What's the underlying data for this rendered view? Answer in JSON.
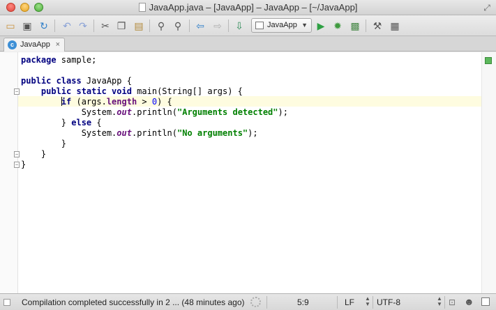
{
  "window": {
    "title": "JavaApp.java – [JavaApp] – JavaApp – [~/JavaApp]"
  },
  "toolbar": {
    "buttons": [
      {
        "name": "open-icon"
      },
      {
        "name": "save-all-icon"
      },
      {
        "name": "synchronize-icon"
      },
      {
        "name": "undo-icon"
      },
      {
        "name": "redo-icon"
      },
      {
        "name": "cut-icon"
      },
      {
        "name": "copy-icon"
      },
      {
        "name": "paste-icon"
      },
      {
        "name": "find-icon"
      },
      {
        "name": "replace-icon"
      },
      {
        "name": "back-icon"
      },
      {
        "name": "forward-icon"
      },
      {
        "name": "make-project-icon"
      },
      {
        "name": "run-icon"
      },
      {
        "name": "debug-icon"
      },
      {
        "name": "coverage-icon"
      },
      {
        "name": "settings-icon"
      },
      {
        "name": "project-structure-icon"
      }
    ],
    "run_config": "JavaApp"
  },
  "tabs": [
    {
      "label": "JavaApp",
      "icon": "class-icon",
      "close": "×",
      "active": true
    }
  ],
  "editor": {
    "lines": [
      "package sample;",
      "",
      "public class JavaApp {",
      "    public static void main(String[] args) {",
      "        if (args.length > 0) {",
      "            System.out.println(\"Arguments detected\");",
      "        } else {",
      "            System.out.println(\"No arguments\");",
      "        }",
      "    }",
      "}"
    ],
    "caret": {
      "line": 5,
      "column": 9
    },
    "inspection_status_color": "#5cb85c"
  },
  "statusbar": {
    "message": "Compilation completed successfully in 2 ... (48 minutes ago)",
    "position": "5:9",
    "line_separator": "LF",
    "encoding": "UTF-8"
  },
  "colors": {
    "keyword": "#000080",
    "string": "#008000",
    "number": "#0000ff",
    "field": "#660e7a",
    "caret_line": "#fefce0"
  }
}
